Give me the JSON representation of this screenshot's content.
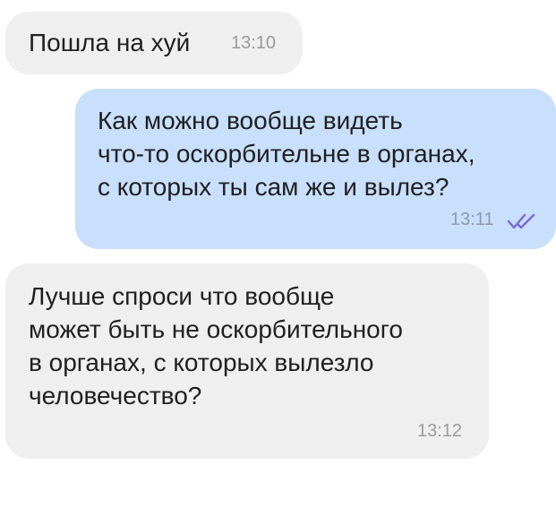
{
  "messages": [
    {
      "direction": "incoming",
      "lines": [
        "Пошла на хуй"
      ],
      "time": "13:10"
    },
    {
      "direction": "outgoing",
      "lines": [
        "Как можно вообще видеть",
        "что-то оскорбительне в органах,",
        "с которых ты сам же и вылез?"
      ],
      "time": "13:11",
      "status_icon": "double-check-icon",
      "status_color": "#7b68d8"
    },
    {
      "direction": "incoming",
      "lines": [
        "Лучше спроси что вообще",
        "может быть не оскорбительного",
        "в органах, с которых вылезло",
        "человечество?"
      ],
      "time": "13:12"
    }
  ],
  "colors": {
    "incoming_bubble": "#efefef",
    "outgoing_bubble": "#c8e0fb",
    "text": "#202020",
    "time": "#9b9b9b"
  }
}
